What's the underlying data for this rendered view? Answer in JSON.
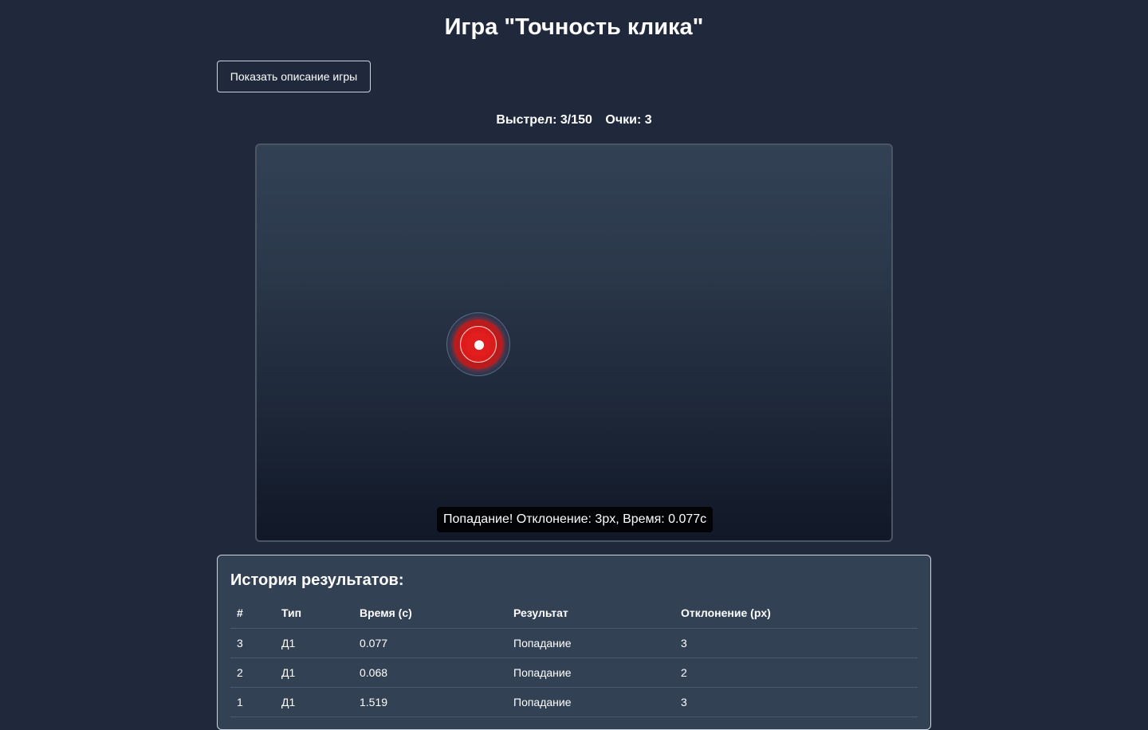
{
  "page": {
    "title": "Игра \"Точность клика\""
  },
  "toolbar": {
    "desc_button_label": "Показать описание игры"
  },
  "stats": {
    "shot_text": "Выстрел: 3/150",
    "score_text": "Очки: 3"
  },
  "game": {
    "feedback": "Попадание! Отклонение: 3px, Время: 0.077с",
    "target_icon": "target-icon",
    "colors": {
      "target_red": "#dc1c1c",
      "background": "#1f293b",
      "panel": "#334155"
    }
  },
  "history": {
    "title": "История результатов:",
    "columns": [
      "#",
      "Тип",
      "Время (с)",
      "Результат",
      "Отклонение (px)"
    ],
    "rows": [
      [
        "3",
        "Д1",
        "0.077",
        "Попадание",
        "3"
      ],
      [
        "2",
        "Д1",
        "0.068",
        "Попадание",
        "2"
      ],
      [
        "1",
        "Д1",
        "1.519",
        "Попадание",
        "3"
      ]
    ]
  }
}
